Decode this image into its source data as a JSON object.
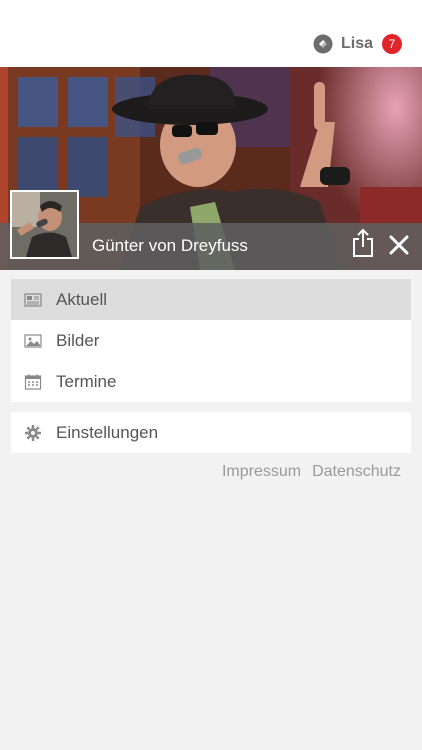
{
  "header": {
    "user_name": "Lisa",
    "notification_count": "7",
    "logo_icon": "diamond-logo-icon"
  },
  "hero": {
    "artist_name": "Günter von Dreyfuss",
    "share_icon": "share-icon",
    "close_icon": "close-icon"
  },
  "menu": {
    "items": [
      {
        "label": "Aktuell",
        "icon": "newspaper-icon",
        "active": true
      },
      {
        "label": "Bilder",
        "icon": "image-icon",
        "active": false
      },
      {
        "label": "Termine",
        "icon": "calendar-icon",
        "active": false
      }
    ]
  },
  "settings": {
    "label": "Einstellungen",
    "icon": "gear-icon"
  },
  "footer": {
    "impressum": "Impressum",
    "datenschutz": "Datenschutz"
  },
  "colors": {
    "badge": "#e0242b",
    "active_item": "#dddddd",
    "info_bar": "#5f5f5f",
    "background": "#f2f2f2"
  }
}
